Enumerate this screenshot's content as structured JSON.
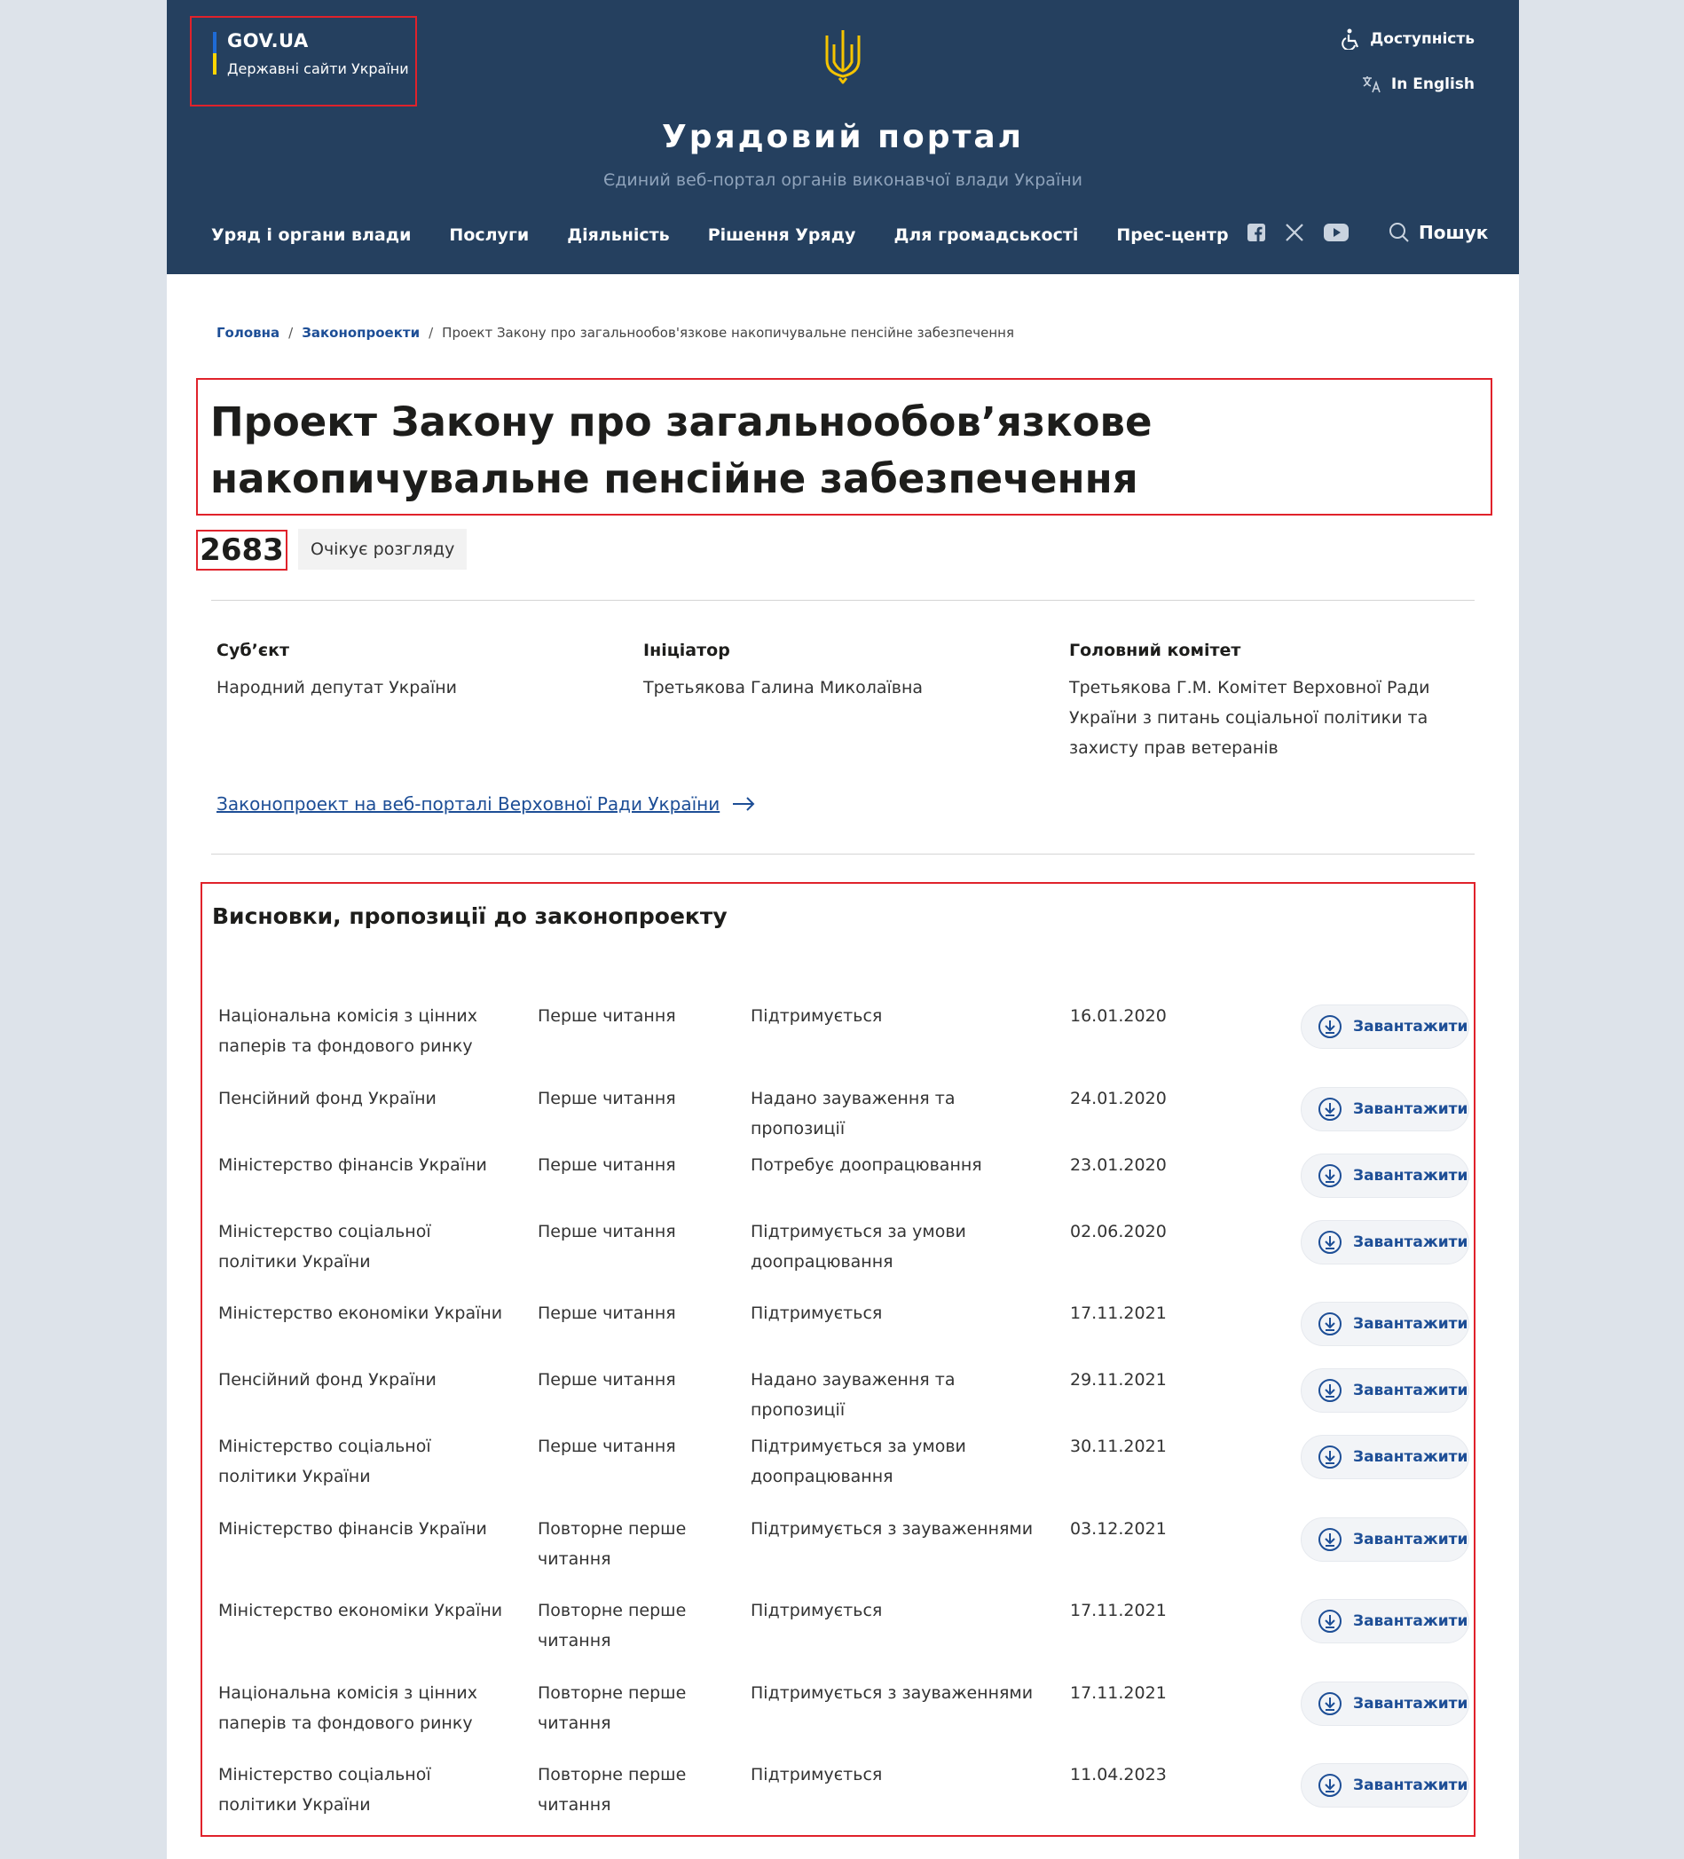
{
  "header": {
    "gov_brand": "GOV.UA",
    "gov_sub": "Державні сайти України",
    "accessibility": "Доступність",
    "language": "In English",
    "portal_title": "Урядовий портал",
    "portal_subtitle": "Єдиний веб-портал органів виконавчої влади України",
    "nav": [
      "Уряд і органи влади",
      "Послуги",
      "Діяльність",
      "Рішення Уряду",
      "Для громадськості",
      "Прес-центр"
    ],
    "search": "Пошук",
    "icons": [
      "facebook-icon",
      "x-icon",
      "youtube-icon",
      "search-icon"
    ],
    "colors": {
      "header_bg": "#25405f",
      "link": "#1d4e96",
      "highlight": "#e0222b"
    }
  },
  "breadcrumb": {
    "home": "Головна",
    "section": "Законопроекти",
    "current": "Проект Закону про загальнообов'язкове накопичувальне пенсійне забезпечення"
  },
  "bill": {
    "title": "Проект Закону про загальнообов’язкове накопичувальне пенсійне забезпечення",
    "number": "2683",
    "status": "Очікує розгляду"
  },
  "meta": {
    "subject_label": "Суб’єкт",
    "subject_value": "Народний депутат України",
    "initiator_label": "Ініціатор",
    "initiator_value": "Третьякова Галина Миколаївна",
    "committee_label": "Головний комітет",
    "committee_value": "Третьякова Г.М. Комітет Верховної Ради України з питань соціальної політики та захисту прав ветеранів"
  },
  "vr_link": "Законопроект на веб-порталі Верховної Ради України",
  "conclusions": {
    "title": "Висновки, пропозиції до законопроекту",
    "download_label": "Завантажити",
    "rows": [
      {
        "org": "Національна комісія з цінних паперів та фондового ринку",
        "stage": "Перше читання",
        "decision": "Підтримується",
        "date": "16.01.2020"
      },
      {
        "org": "Пенсійний фонд України",
        "stage": "Перше читання",
        "decision": "Надано зауваження та пропозиції",
        "date": "24.01.2020"
      },
      {
        "org": "Міністерство фінансів України",
        "stage": "Перше читання",
        "decision": "Потребує доопрацювання",
        "date": "23.01.2020"
      },
      {
        "org": "Міністерство соціальної політики України",
        "stage": "Перше читання",
        "decision": "Підтримується за умови доопрацювання",
        "date": "02.06.2020"
      },
      {
        "org": "Міністерство економіки України",
        "stage": "Перше читання",
        "decision": "Підтримується",
        "date": "17.11.2021"
      },
      {
        "org": "Пенсійний фонд України",
        "stage": "Перше читання",
        "decision": "Надано зауваження та пропозиції",
        "date": "29.11.2021"
      },
      {
        "org": "Міністерство соціальної політики України",
        "stage": "Перше читання",
        "decision": "Підтримується за умови доопрацювання",
        "date": "30.11.2021"
      },
      {
        "org": "Міністерство фінансів України",
        "stage": "Повторне перше читання",
        "decision": "Підтримується з зауваженнями",
        "date": "03.12.2021"
      },
      {
        "org": "Міністерство економіки України",
        "stage": "Повторне перше читання",
        "decision": "Підтримується",
        "date": "17.11.2021"
      },
      {
        "org": "Національна комісія з цінних паперів та фондового ринку",
        "stage": "Повторне перше читання",
        "decision": "Підтримується з зауваженнями",
        "date": "17.11.2021"
      },
      {
        "org": "Міністерство соціальної політики України",
        "stage": "Повторне перше читання",
        "decision": "Підтримується",
        "date": "11.04.2023"
      }
    ]
  }
}
